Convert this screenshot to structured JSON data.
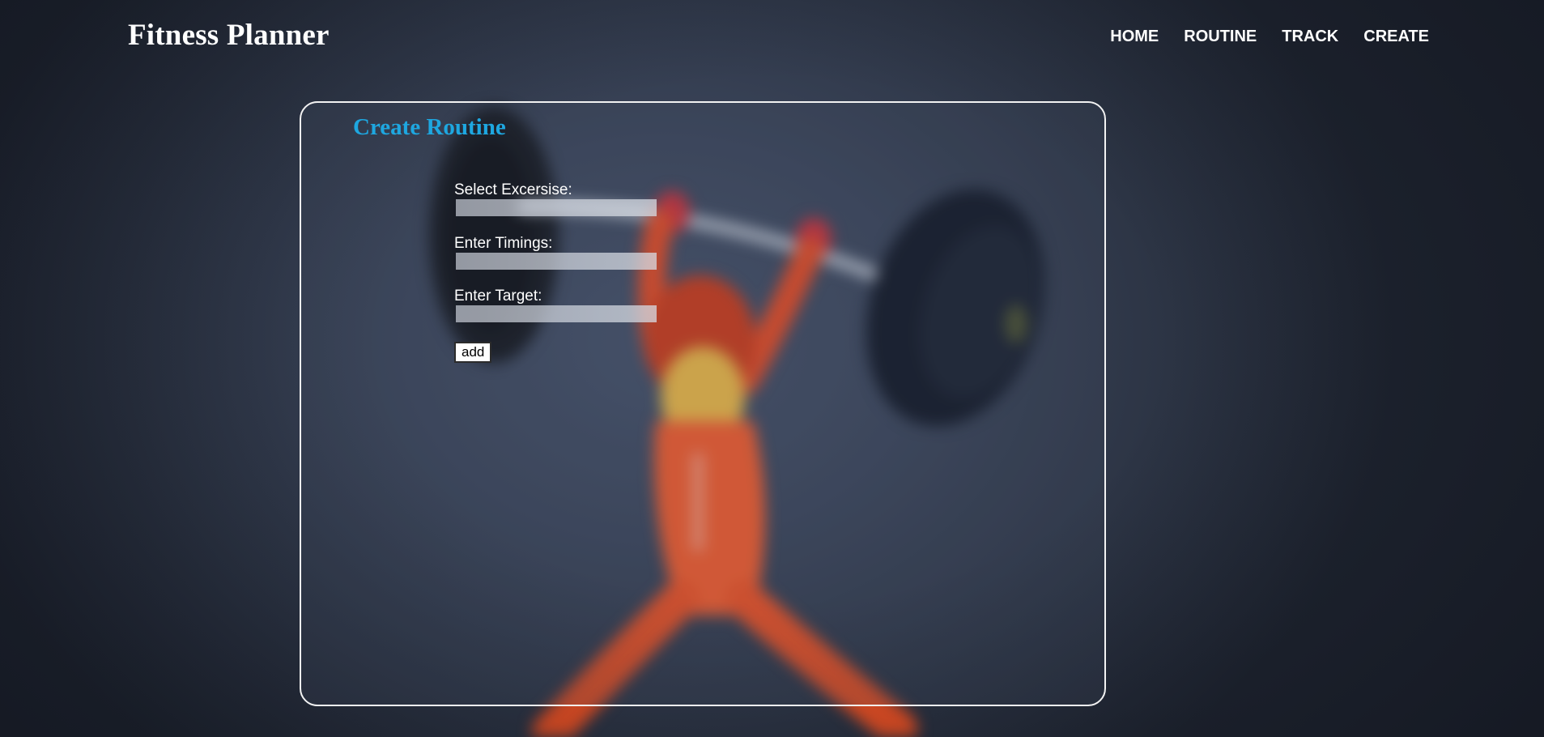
{
  "header": {
    "site_title": "Fitness Planner",
    "nav": [
      {
        "label": "HOME"
      },
      {
        "label": "ROUTINE"
      },
      {
        "label": "TRACK"
      },
      {
        "label": "CREATE"
      }
    ]
  },
  "create_routine": {
    "title": "Create Routine",
    "fields": [
      {
        "label": "Select Excersise:",
        "value": ""
      },
      {
        "label": "Enter Timings:",
        "value": ""
      },
      {
        "label": "Enter Target:",
        "value": ""
      }
    ],
    "add_button": "add"
  },
  "colors": {
    "accent_title": "#1ea7e0",
    "background": "#3a4459",
    "card_border": "#f2f2f2"
  }
}
